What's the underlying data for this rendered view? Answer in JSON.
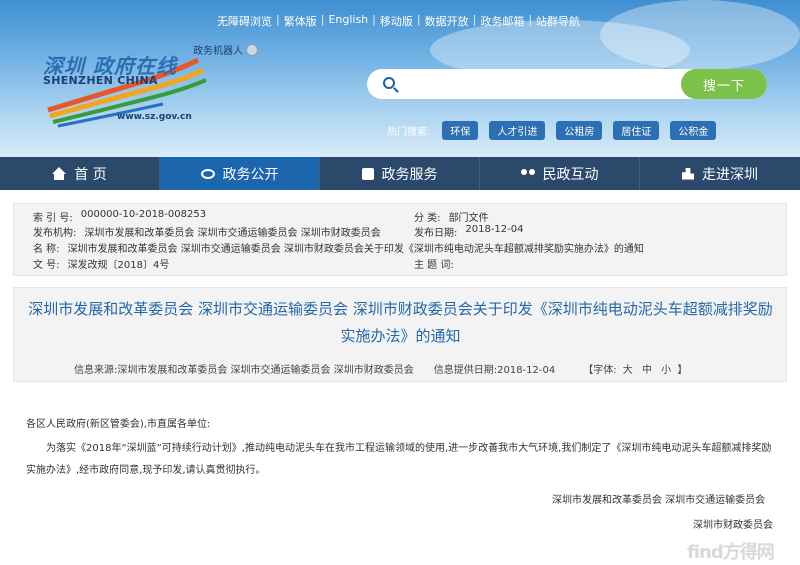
{
  "header": {
    "top_links": [
      "无障碍浏览",
      "繁体版",
      "English",
      "移动版",
      "数据开放",
      "政务邮箱",
      "站群导航"
    ],
    "logo_title": "深圳 政府在线",
    "logo_sub": "SHENZHEN CHINA",
    "logo_url": "www.sz.gov.cn",
    "robot_label": "政务机器人",
    "search_placeholder": "",
    "search_button": "搜一下",
    "hot_label": "热门搜索:",
    "hot_tags": [
      "环保",
      "人才引进",
      "公租房",
      "居住证",
      "公积金"
    ]
  },
  "nav": {
    "items": [
      {
        "label": "首 页",
        "icon": "home-icon"
      },
      {
        "label": "政务公开",
        "icon": "gov-icon"
      },
      {
        "label": "政务服务",
        "icon": "service-icon"
      },
      {
        "label": "民政互动",
        "icon": "people-icon"
      },
      {
        "label": "走进深圳",
        "icon": "city-icon"
      }
    ],
    "active_index": 1
  },
  "meta": {
    "index_key": "索 引 号:",
    "index_val": "000000-10-2018-008253",
    "category_key": "分 类:",
    "category_val": "部门文件",
    "issuer_key": "发布机构:",
    "issuer_val": "深圳市发展和改革委员会 深圳市交通运输委员会 深圳市财政委员会",
    "date_key": "发布日期:",
    "date_val": "2018-12-04",
    "name_key": "名 称:",
    "name_val": "深圳市发展和改革委员会 深圳市交通运输委员会 深圳市财政委员会关于印发《深圳市纯电动泥头车超额减排奖励实施办法》的通知",
    "docno_key": "文 号:",
    "docno_val": "深发改规〔2018〕4号",
    "subject_key": "主 题 词:",
    "subject_val": ""
  },
  "article": {
    "title": "深圳市发展和改革委员会 深圳市交通运输委员会 深圳市财政委员会关于印发《深圳市纯电动泥头车超额减排奖励实施办法》的通知",
    "source": "信息来源:深圳市发展和改革委员会 深圳市交通运输委员会 深圳市财政委员会",
    "provide_date": "信息提供日期:2018-12-04",
    "font_label": "【字体:",
    "font_sizes": [
      "大",
      "中",
      "小"
    ],
    "font_close": "】",
    "salutation": "各区人民政府(新区管委会),市直属各单位:",
    "paragraph": "为落实《2018年“深圳蓝”可持续行动计划》,推动纯电动泥头车在我市工程运输领域的使用,进一步改善我市大气环境,我们制定了《深圳市纯电动泥头车超额减排奖励实施办法》,经市政府同意,现予印发,请认真贯彻执行。",
    "signature1": "深圳市发展和改革委员会 深圳市交通运输委员会",
    "signature2": "深圳市财政委员会"
  },
  "watermark": "find方得网"
}
